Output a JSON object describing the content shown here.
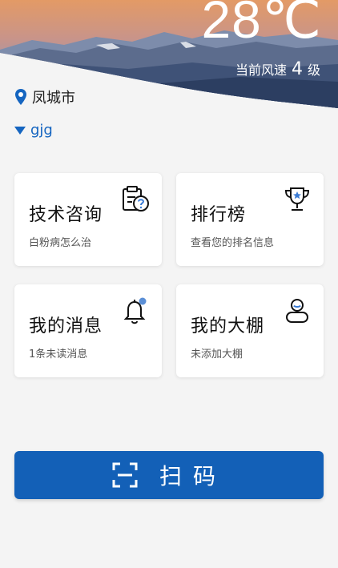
{
  "weather": {
    "temperature": "28℃",
    "wind_prefix": "当前风速",
    "wind_level": "4",
    "wind_suffix": "级"
  },
  "location": {
    "city": "凤城市",
    "icon": "location-pin-icon"
  },
  "user": {
    "name": "gjg",
    "icon": "caret-down-icon"
  },
  "cards": [
    {
      "title": "技术咨询",
      "subtitle": "白粉病怎么治",
      "icon": "clipboard-question-icon"
    },
    {
      "title": "排行榜",
      "subtitle": "查看您的排名信息",
      "icon": "trophy-icon"
    },
    {
      "title": "我的消息",
      "subtitle": "1条未读消息",
      "icon": "bell-icon"
    },
    {
      "title": "我的大棚",
      "subtitle": "未添加大棚",
      "icon": "user-icon"
    }
  ],
  "scan_button": {
    "label": "扫码",
    "icon": "scan-icon"
  },
  "colors": {
    "primary": "#1360b7",
    "accent_blue": "#1565c0",
    "notification_dot": "#5b8fd6"
  }
}
